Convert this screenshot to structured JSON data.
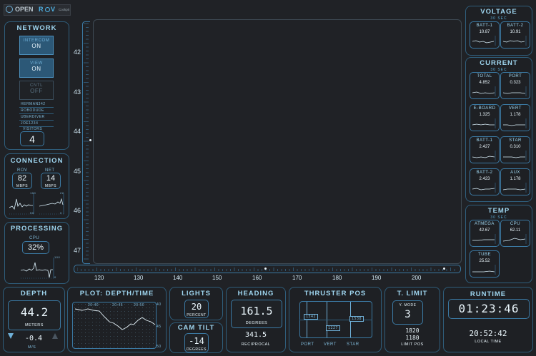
{
  "app": {
    "brand_open": "OPEN",
    "brand_r": "R",
    "brand_v": "V",
    "brand_sub": "Cockpit"
  },
  "network": {
    "title": "NETWORK",
    "intercom": {
      "label": "INTERCOM",
      "state": "ON"
    },
    "view": {
      "label": "VIEW",
      "state": "ON"
    },
    "cntl": {
      "label": "CNTL",
      "state": "OFF"
    },
    "users": [
      "HERMAN342",
      "ROBODUDE",
      "UBERDIVER",
      "JOE1234"
    ],
    "visitors_label": "VISITORS",
    "visitors": "4"
  },
  "connection": {
    "title": "CONNECTION",
    "rov": {
      "label": "ROV",
      "value": "82",
      "unit": "MBPS"
    },
    "net": {
      "label": "NET",
      "value": "14",
      "unit": "MBPS"
    },
    "spark_left": {
      "top": "100",
      "bottom": "50"
    },
    "spark_right": {
      "top": "22",
      "bottom": "0"
    }
  },
  "processing": {
    "title": "PROCESSING",
    "cpu_label": "CPU",
    "cpu_value": "32%",
    "spark_top": "100",
    "spark_bottom": "0"
  },
  "depth": {
    "title": "DEPTH",
    "value": "44.2",
    "unit": "METERS",
    "rate": "-0.4",
    "rate_unit": "M/S"
  },
  "plot": {
    "title": "PLOT: DEPTH/TIME",
    "times": [
      "20:40",
      "20:45",
      "20:50"
    ],
    "axis": [
      "40",
      "45",
      "50"
    ]
  },
  "lights": {
    "title": "LIGHTS",
    "value": "20",
    "unit": "PERCENT"
  },
  "camtilt": {
    "title": "CAM TILT",
    "value": "-14",
    "unit": "DEGREES"
  },
  "heading": {
    "title": "HEADING",
    "value": "161.5",
    "unit": "DEGREES",
    "reciprocal": "341.5",
    "reciprocal_label": "RECIPROCAL"
  },
  "thruster": {
    "title": "THRUSTER POS",
    "port": "1542",
    "vert": "1227",
    "star": "1538",
    "labels": [
      "PORT",
      "VERT",
      "STAR"
    ]
  },
  "tlimit": {
    "title": "T. LIMIT",
    "mode_label": "Y. MODE",
    "mode": "3",
    "v1": "1820",
    "v2": "1180",
    "limit_label": "LIMIT POS"
  },
  "runtime": {
    "title": "RUNTIME",
    "elapsed": "01:23:46",
    "local": "20:52:42",
    "local_label": "LOCAL TIME"
  },
  "voltage": {
    "title": "VOLTAGE",
    "sub": "30 SEC",
    "cards": [
      {
        "label": "BATT-1",
        "value": "10.87"
      },
      {
        "label": "BATT-2",
        "value": "10.91"
      }
    ]
  },
  "current": {
    "title": "CURRENT",
    "sub": "30 SEC",
    "cards": [
      {
        "label": "TOTAL",
        "value": "4.852"
      },
      {
        "label": "PORT",
        "value": "0.323"
      },
      {
        "label": "E-BOARD",
        "value": "1.325"
      },
      {
        "label": "VERT",
        "value": "1.178"
      },
      {
        "label": "BATT-1",
        "value": "2.427"
      },
      {
        "label": "STAR",
        "value": "0.310"
      },
      {
        "label": "BATT-2",
        "value": "2.423"
      },
      {
        "label": "AUX",
        "value": "1.178"
      }
    ]
  },
  "temp": {
    "title": "TEMP",
    "sub": "30 SEC",
    "cards": [
      {
        "label": "ATMEGA",
        "value": "42.67"
      },
      {
        "label": "CPU",
        "value": "62.11"
      },
      {
        "label": "TUBE",
        "value": "25.52"
      }
    ]
  },
  "main_view": {
    "y_ticks": [
      "42",
      "43",
      "44",
      "45",
      "46",
      "47"
    ],
    "x_ticks": [
      "120",
      "130",
      "140",
      "150",
      "160",
      "170",
      "180",
      "190",
      "200"
    ]
  },
  "colors": {
    "accent": "#3b79a3",
    "text": "#cfe6f2",
    "bg": "#202226"
  }
}
